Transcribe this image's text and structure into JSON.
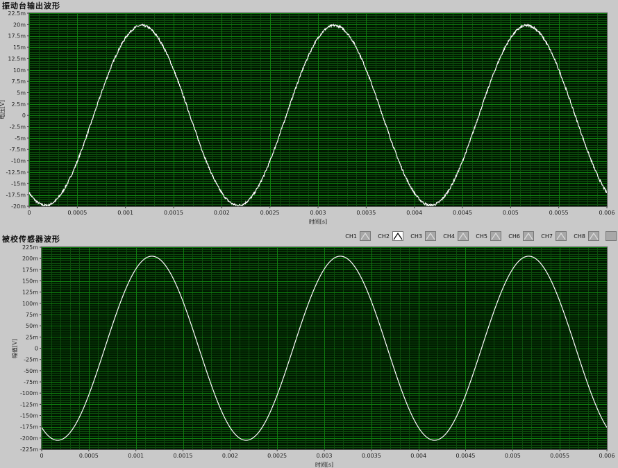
{
  "panels": [
    {
      "title": "振动台输出波形",
      "chart_data": {
        "type": "line",
        "xlabel": "时间[s]",
        "ylabel": "电压[V]",
        "xlim": [
          0,
          0.006
        ],
        "ylim": [
          -0.02,
          0.0225
        ],
        "x_ticks": [
          0,
          0.0005,
          0.001,
          0.0015,
          0.002,
          0.0025,
          0.003,
          0.0035,
          0.004,
          0.0045,
          0.005,
          0.0055,
          0.006
        ],
        "x_tick_labels": [
          "0",
          "0.0005",
          "0.001",
          "0.0015",
          "0.002",
          "0.0025",
          "0.003",
          "0.0035",
          "0.004",
          "0.0045",
          "0.005",
          "0.0055",
          "0.006"
        ],
        "y_ticks": [
          0.0225,
          0.02,
          0.0175,
          0.015,
          0.0125,
          0.01,
          0.0075,
          0.005,
          0.0025,
          0,
          -0.0025,
          -0.005,
          -0.0075,
          -0.01,
          -0.0125,
          -0.015,
          -0.0175,
          -0.02
        ],
        "y_tick_labels": [
          "22.5m",
          "20m",
          "17.5m",
          "15m",
          "12.5m",
          "10m",
          "7.5m",
          "5m",
          "2.5m",
          "0",
          "-2.5m",
          "-5m",
          "-7.5m",
          "-10m",
          "-12.5m",
          "-15m",
          "-17.5m",
          "-20m"
        ],
        "grid": true,
        "series": [
          {
            "name": "",
            "color": "#ffffff",
            "waveform": "sine",
            "amplitude": 0.0198,
            "frequency_hz": 500,
            "peak_time_s": 0.00117,
            "noise": 0.00025
          }
        ]
      }
    },
    {
      "title": "被校传感器波形",
      "chart_data": {
        "type": "line",
        "xlabel": "时间[s]",
        "ylabel": "幅值[V]",
        "xlim": [
          0,
          0.006
        ],
        "ylim": [
          -0.225,
          0.225
        ],
        "x_ticks": [
          0,
          0.0005,
          0.001,
          0.0015,
          0.002,
          0.0025,
          0.003,
          0.0035,
          0.004,
          0.0045,
          0.005,
          0.0055,
          0.006
        ],
        "x_tick_labels": [
          "0",
          "0.0005",
          "0.001",
          "0.0015",
          "0.002",
          "0.0025",
          "0.003",
          "0.0035",
          "0.004",
          "0.0045",
          "0.005",
          "0.0055",
          "0.006"
        ],
        "y_ticks": [
          0.225,
          0.2,
          0.175,
          0.15,
          0.125,
          0.1,
          0.075,
          0.05,
          0.025,
          0,
          -0.025,
          -0.05,
          -0.075,
          -0.1,
          -0.125,
          -0.15,
          -0.175,
          -0.2,
          -0.225
        ],
        "y_tick_labels": [
          "225m",
          "200m",
          "175m",
          "150m",
          "125m",
          "100m",
          "75m",
          "50m",
          "25m",
          "0",
          "-25m",
          "-50m",
          "-75m",
          "-100m",
          "-125m",
          "-150m",
          "-175m",
          "-200m",
          "-225m"
        ],
        "grid": true,
        "series": [
          {
            "name": "",
            "color": "#ffffff",
            "waveform": "sine",
            "amplitude": 0.205,
            "frequency_hz": 500,
            "peak_time_s": 0.00117,
            "noise": 0
          }
        ]
      }
    }
  ],
  "legend": {
    "items": [
      "CH1",
      "CH2",
      "CH3",
      "CH4",
      "CH5",
      "CH6",
      "CH7",
      "CH8"
    ],
    "active": "CH2"
  },
  "colors": {
    "plot_background": "#001a00",
    "major_grid": "#0f7a0f",
    "minor_grid": "#0c4a0c",
    "trace": "#ffffff",
    "frame": "#c9c9c9"
  }
}
